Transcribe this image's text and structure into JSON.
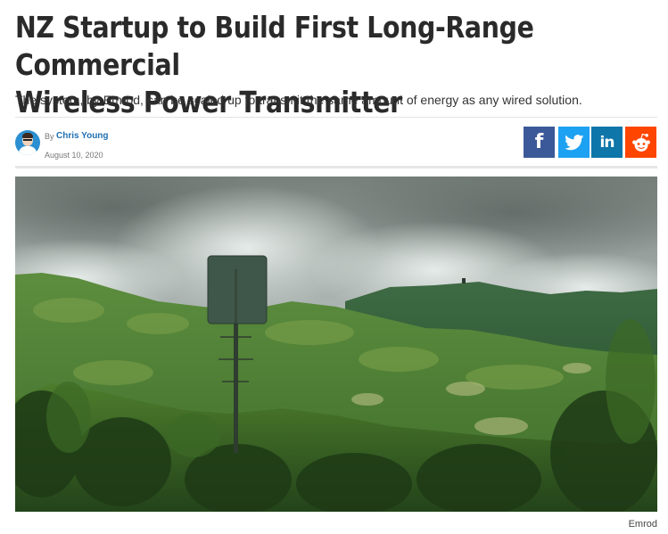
{
  "article": {
    "headline_line1": "NZ Startup to Build First Long-Range Commercial",
    "headline_line2": "Wireless Power Transmitter",
    "subheadline": "The system, by Emrod, can be scaled up to transmit the same amount of energy as any wired solution.",
    "byline_prefix": "By",
    "author": "Chris Young",
    "date": "August 10, 2020",
    "image_caption": "Emrod"
  },
  "share": {
    "facebook_label": "f",
    "linkedin_label": "in",
    "icons": [
      "facebook-icon",
      "twitter-icon",
      "linkedin-icon",
      "reddit-icon"
    ],
    "colors": {
      "facebook": "#3b5998",
      "twitter": "#1da1f2",
      "linkedin": "#0e76a8",
      "reddit": "#ff4500"
    }
  },
  "colors": {
    "author_link": "#1f6fb2",
    "headline": "#2a2a2a"
  }
}
